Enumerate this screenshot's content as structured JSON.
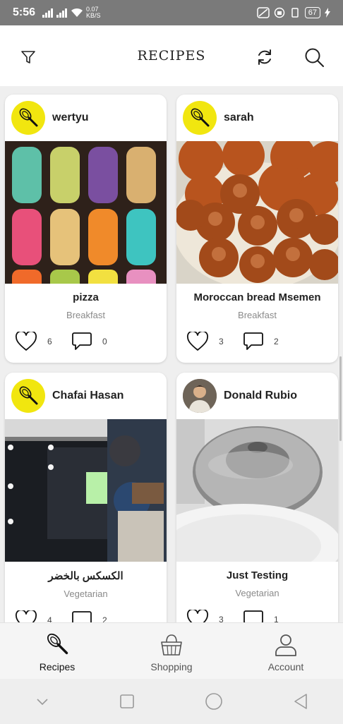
{
  "status_bar": {
    "time": "5:56",
    "data_rate": "0.07",
    "data_unit": "KB/S",
    "battery": "67"
  },
  "header": {
    "title": "RECIPES"
  },
  "recipes": [
    {
      "username": "wertyu",
      "title": "pizza",
      "category": "Breakfast",
      "likes": "6",
      "comments": "0",
      "avatar": "whisk-icon"
    },
    {
      "username": "sarah",
      "title": "Moroccan bread Msemen",
      "category": "Breakfast",
      "likes": "3",
      "comments": "2",
      "avatar": "whisk-icon"
    },
    {
      "username": "Chafai Hasan",
      "title": "الكسكس بالخضر",
      "category": "Vegetarian",
      "likes": "4",
      "comments": "2",
      "avatar": "whisk-icon"
    },
    {
      "username": "Donald Rubio",
      "title": "Just Testing",
      "category": "Vegetarian",
      "likes": "3",
      "comments": "1",
      "avatar": "user-photo"
    }
  ],
  "bottom_nav": [
    {
      "label": "Recipes",
      "icon": "whisk-icon",
      "active": true
    },
    {
      "label": "Shopping",
      "icon": "basket-icon",
      "active": false
    },
    {
      "label": "Account",
      "icon": "person-icon",
      "active": false
    }
  ],
  "colors": {
    "avatar_yellow": "#f1e60f",
    "status_bar": "#7a7a7a"
  }
}
